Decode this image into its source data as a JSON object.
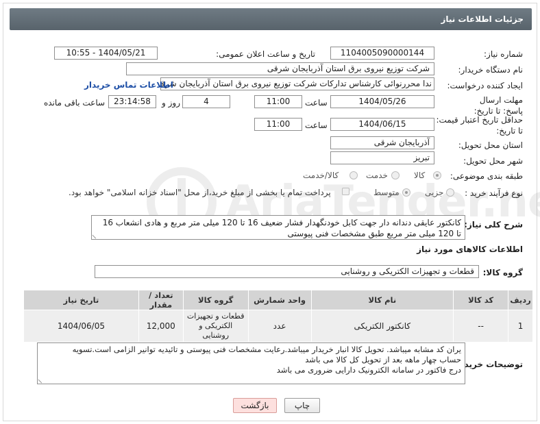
{
  "header": {
    "title": "جزئیات اطلاعات نیاز"
  },
  "fields": {
    "need_number_label": "شماره نیاز:",
    "need_number": "1104005090000144",
    "announce_label": "تاریخ و ساعت اعلان عمومی:",
    "announce_value": "1404/05/21 - 10:55",
    "buyer_org_label": "نام دستگاه خریدار:",
    "buyer_org": "شرکت توزیع نیروی برق استان آذربایجان شرقی",
    "creator_label": "ایجاد کننده درخواست:",
    "creator": "ندا محررنوائی کارشناس تدارکات شرکت توزیع نیروی برق استان آذربایجان شرقی",
    "contact_link": "اطلاعات تماس خریدار",
    "send_deadline_label": "مهلت ارسال پاسخ: تا تاریخ:",
    "send_date": "1404/05/26",
    "time_label": "ساعت",
    "send_time": "11:00",
    "days_value": "4",
    "day_and_label": "روز و",
    "remaining_time": "23:14:58",
    "remaining_label": "ساعت باقی مانده",
    "validity_label": "حداقل تاریخ اعتبار قیمت: تا تاریخ:",
    "validity_date": "1404/06/15",
    "validity_time": "11:00",
    "province_label": "استان محل تحویل:",
    "province": "آذربایجان شرقی",
    "city_label": "شهر محل تحویل:",
    "city": "تبریز",
    "category_label": "طبقه بندی موضوعی:",
    "category_options": [
      "کالا",
      "خدمت",
      "کالا/خدمت"
    ],
    "process_label": "نوع فرآیند خرید :",
    "process_options": [
      "جزیی",
      "متوسط"
    ],
    "payment_note": "پرداخت تمام یا بخشی از مبلغ خرید،از محل \"اسناد خزانه اسلامی\" خواهد بود."
  },
  "description": {
    "label": "شرح کلی نیاز:",
    "text": "کانکتور عایقی دندانه دار جهت کابل خودنگهدار فشار ضعیف 16 تا 120 میلی متر مربع و هادی انشعاب 16 تا 120 میلی متر مربع طبق مشخصات فنی پیوستی"
  },
  "goods_section": {
    "title": "اطلاعات کالاهای مورد نیاز",
    "group_label": "گروه کالا:",
    "group_value": "قطعات و تجهیزات الکتریکی و روشنایی"
  },
  "table": {
    "headers": [
      "ردیف",
      "کد کالا",
      "نام کالا",
      "واحد شمارش",
      "گروه کالا",
      "تعداد / مقدار",
      "تاریخ نیاز"
    ],
    "rows": [
      [
        "1",
        "--",
        "کانکتور الکتریکی",
        "عدد",
        "قطعات و تجهیزات الکتریکی و روشنایی",
        "12,000",
        "1404/06/05"
      ]
    ]
  },
  "buyer_notes": {
    "label": "توضیحات خریدار:",
    "lines": [
      "یران کد مشابه میباشد. تحویل کالا انبار خریدار میباشد.رعایت مشخصات فنی پیوستی و تائیدیه توانیر الزامی است.تسویه",
      "حساب چهار ماهه بعد از تحویل کل کالا می باشد",
      "درج فاکتور در سامانه الکترونیک دارایی ضروری می باشد"
    ]
  },
  "buttons": {
    "print": "چاپ",
    "back": "بازگشت"
  },
  "watermark": {
    "text": "AriaTender.net"
  },
  "colors": {
    "header_bg": "#5f6b73",
    "link": "#1e4fa6",
    "back_button": "#fde0de"
  }
}
